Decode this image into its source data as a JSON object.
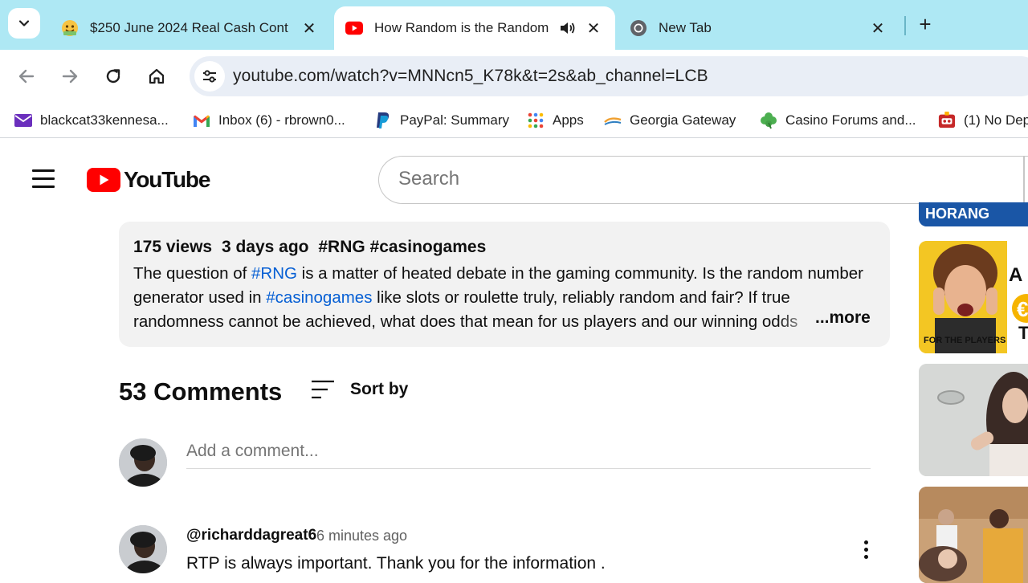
{
  "browser": {
    "tabs": [
      {
        "title": "$250 June 2024 Real Cash Cont",
        "active": false
      },
      {
        "title": "How Random is the Random",
        "active": true
      },
      {
        "title": "New Tab",
        "active": false
      }
    ],
    "url": "youtube.com/watch?v=MNNcn5_K78k&t=2s&ab_channel=LCB",
    "bookmarks": [
      {
        "label": "blackcat33kennesa...",
        "icon": "mail-icon"
      },
      {
        "label": "Inbox (6) - rbrown0...",
        "icon": "gmail-icon"
      },
      {
        "label": "PayPal: Summary",
        "icon": "paypal-icon"
      },
      {
        "label": "Apps",
        "icon": "apps-grid-icon"
      },
      {
        "label": "Georgia Gateway",
        "icon": "georgia-gateway-icon"
      },
      {
        "label": "Casino Forums and...",
        "icon": "clover-icon"
      },
      {
        "label": "(1) No Dep",
        "icon": "casino-icon"
      }
    ]
  },
  "youtube": {
    "logo_text": "YouTube",
    "search_placeholder": "Search",
    "description": {
      "views": "175 views",
      "age": "3 days ago",
      "tags": "#RNG #casinogames",
      "text_part1": "The question of ",
      "link1": "#RNG",
      "text_part2": " is a matter of heated debate in the gaming community. Is the random number generator used in ",
      "link2": "#casinogames",
      "text_part3": " like slots or roulette truly, reliably random and fair? If true randomness cannot be achieved, what does that mean for us players and our winning odds",
      "more_label": "...more"
    },
    "comments": {
      "count_label": "53 Comments",
      "sort_label": "Sort by",
      "add_placeholder": "Add a comment...",
      "items": [
        {
          "author": "@richarddagreat6",
          "time": "6 minutes ago",
          "text": "RTP is always important. Thank you for the information ."
        }
      ]
    },
    "sidebar_thumbs": [
      {
        "caption": "FOR THE PLAYERS"
      }
    ]
  },
  "colors": {
    "tabstrip": "#aee8f4",
    "link": "#065fd4",
    "yt_red": "#ff0000"
  }
}
